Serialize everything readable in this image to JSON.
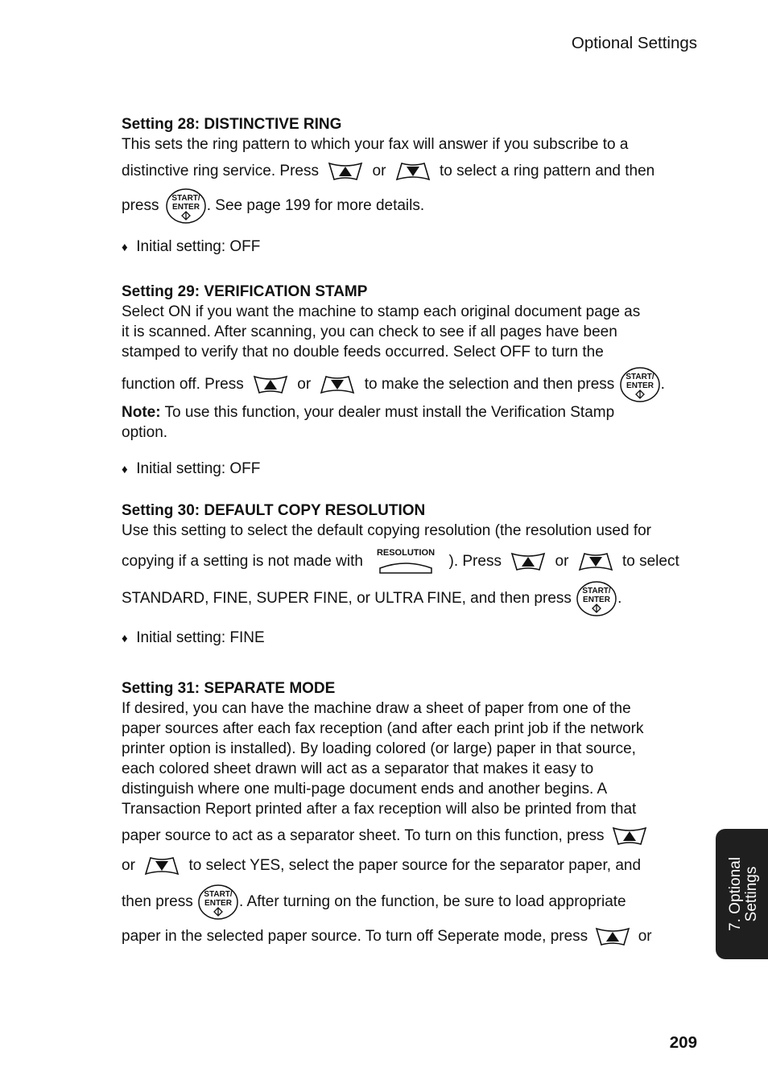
{
  "header": {
    "title": "Optional Settings"
  },
  "footer": {
    "page_number": "209"
  },
  "side_tab": {
    "line1": "7. Optional",
    "line2": "Settings"
  },
  "icons": {
    "up": "up-arrow-key-icon",
    "down": "down-arrow-key-icon",
    "start": "start-enter-key-icon",
    "resolution": "resolution-key-icon",
    "start_label_1": "START/",
    "start_label_2": "ENTER",
    "resolution_label": "RESOLUTION"
  },
  "bullet_glyph": "♦",
  "s28": {
    "heading": "Setting 28: DISTINCTIVE RING",
    "t1": "This sets the ring pattern to which your fax will answer if you subscribe to a",
    "t2a": "distinctive ring service. Press",
    "or": "or",
    "t2b": "to select a ring pattern and then",
    "t3a": "press",
    "t3b": ". See page 199 for more details.",
    "initial": "Initial setting: OFF"
  },
  "s29": {
    "heading": "Setting 29: VERIFICATION STAMP",
    "t1": "Select ON if you want the machine to stamp each original document page as",
    "t2": "it is scanned. After scanning, you can check to see if all pages have been",
    "t3": "stamped to verify that no double feeds occurred. Select OFF to turn the",
    "t4a": "function off. Press",
    "or": "or",
    "t4b": "to make the selection and then press",
    "t4c": ".",
    "note_label": "Note:",
    "note1": " To use this function, your dealer must install the Verification Stamp",
    "note2": "option.",
    "initial": "Initial setting: OFF"
  },
  "s30": {
    "heading": "Setting 30: DEFAULT COPY RESOLUTION",
    "t1": "Use this setting to select the default copying resolution (the resolution used for",
    "t2a": "copying if a setting is not made with",
    "t2b": "). Press",
    "or": "or",
    "t2c": "to select",
    "t3a": "STANDARD, FINE, SUPER FINE, or ULTRA FINE, and then press",
    "t3b": ".",
    "initial": "Initial setting: FINE"
  },
  "s31": {
    "heading": "Setting 31: SEPARATE MODE",
    "t1": "If desired, you can have the machine draw a sheet of paper from one of the",
    "t2": "paper sources after each fax reception (and after each print job if the network",
    "t3": "printer option is installed). By loading colored (or large) paper in that source,",
    "t4": "each colored sheet drawn will act as a separator that makes it easy to",
    "t5": "distinguish where one multi-page document ends and another begins. A",
    "t6": "Transaction Report printed after a fax reception will also be printed from that",
    "t7": "paper source to act as a separator sheet. To turn on this function, press",
    "t8a": "or",
    "t8b": "to select YES, select the paper source for the separator paper, and",
    "t9a": "then press",
    "t9b": ". After turning on the function, be sure to load appropriate",
    "t10a": "paper in the selected paper source. To turn off Seperate mode, press",
    "t10b": "or"
  }
}
